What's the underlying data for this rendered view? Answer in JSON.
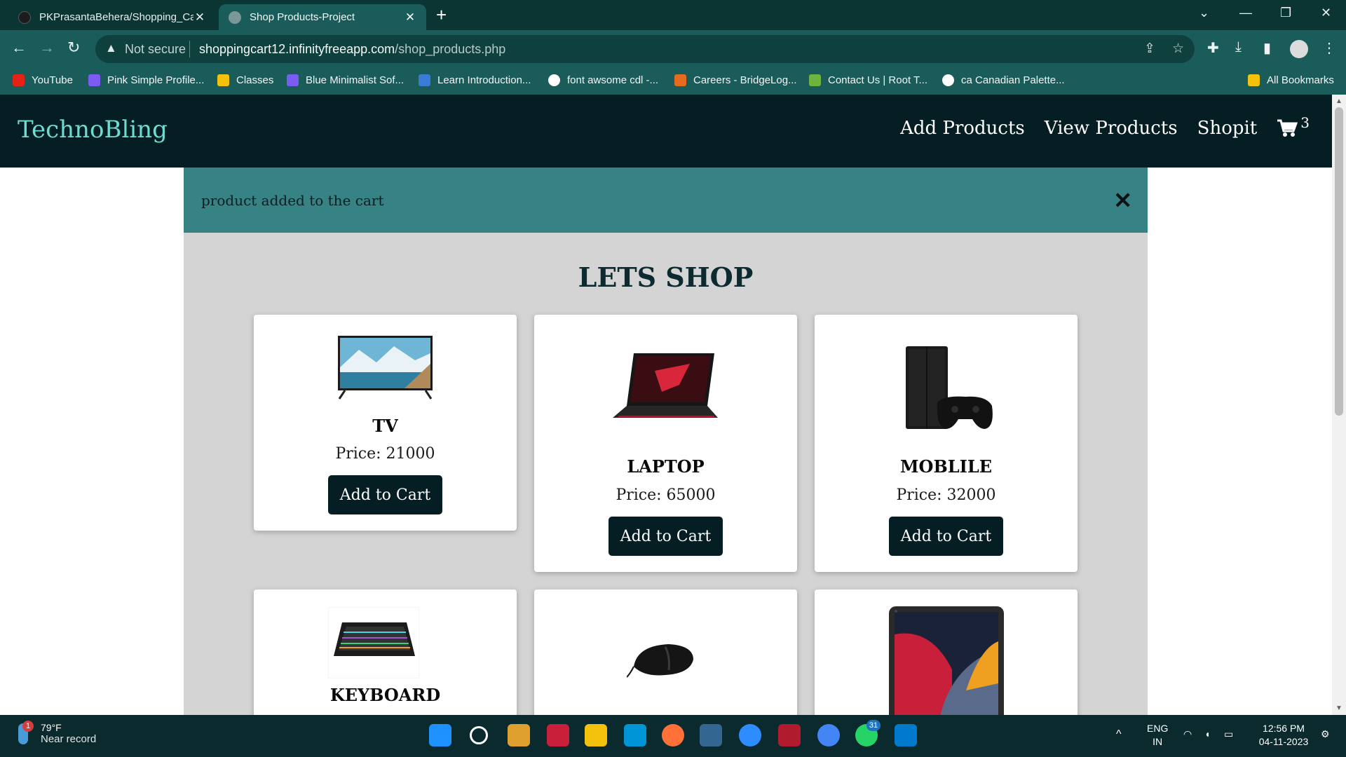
{
  "browser": {
    "tabs": [
      {
        "title": "PKPrasantaBehera/Shopping_Ca",
        "active": false
      },
      {
        "title": "Shop Products-Project",
        "active": true
      }
    ],
    "security_label": "Not secure",
    "url_host": "shoppingcart12.infinityfreeapp.com",
    "url_path": "/shop_products.php",
    "bookmarks": [
      "YouTube",
      "Pink Simple Profile...",
      "Classes",
      "Blue Minimalist Sof...",
      "Learn Introduction...",
      "font awsome cdl -...",
      "Careers - BridgeLog...",
      "Contact Us | Root T...",
      "ca Canadian Palette..."
    ],
    "all_bookmarks": "All Bookmarks"
  },
  "site": {
    "brand": "TechnoBling",
    "nav": [
      "Add Products",
      "View Products",
      "Shopit"
    ],
    "cart_count": "3",
    "alert": "product added to the cart",
    "close_symbol": "✕",
    "heading": "LETS SHOP",
    "products": [
      {
        "name": "TV",
        "price": "Price: 21000",
        "button": "Add to Cart"
      },
      {
        "name": "LAPTOP",
        "price": "Price: 65000",
        "button": "Add to Cart"
      },
      {
        "name": "MOBLILE",
        "price": "Price: 32000",
        "button": "Add to Cart"
      },
      {
        "name": "KEYBOARD"
      }
    ]
  },
  "taskbar": {
    "temp": "79°F",
    "weather": "Near record",
    "weather_badge": "1",
    "whatsapp_badge": "31",
    "lang": "ENG",
    "region": "IN",
    "time": "12:56 PM",
    "date": "04-11-2023"
  },
  "colors": {
    "nav_bg": "#051e24",
    "brand": "#6fdcd2",
    "alert_bg": "#378285",
    "container_bg": "#d4d4d4",
    "button_bg": "#051e24"
  }
}
